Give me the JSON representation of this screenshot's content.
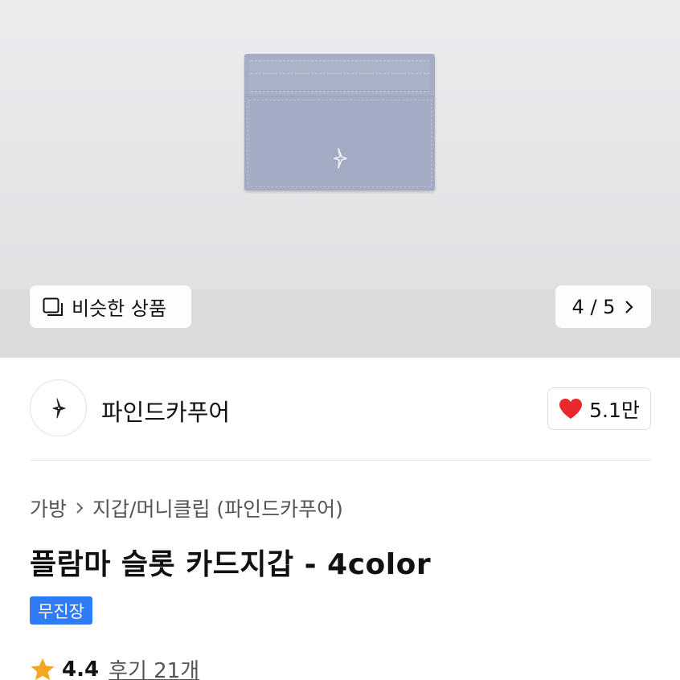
{
  "hero": {
    "similar_button_label": "비슷한 상품",
    "similar_icon": "similar-products-icon",
    "counter": "4 / 5",
    "next_icon": "chevron-right-icon"
  },
  "brand": {
    "name": "파인드카푸어",
    "logo_icon": "findkapoor-logo-icon",
    "like_icon": "heart-icon",
    "like_count": "5.1만",
    "like_color": "#e8282b"
  },
  "product": {
    "breadcrumb": [
      "가방",
      "지갑/머니클립 (파인드카푸어)"
    ],
    "breadcrumb_separator_icon": "chevron-right-icon",
    "title": "플람마 슬롯 카드지갑 - 4color",
    "badge": "무진장",
    "badge_color": "#2f7cf6",
    "rating": "4.4",
    "rating_icon": "star-icon",
    "star_color": "#f5a623",
    "reviews": "후기 21개"
  }
}
